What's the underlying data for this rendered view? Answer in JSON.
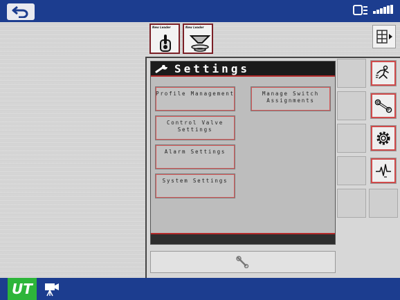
{
  "settings": {
    "title": "Settings",
    "buttons": [
      {
        "label": "Profile Management"
      },
      {
        "label": "Manage Switch Assignments"
      },
      {
        "label": "Control Valve Settings"
      },
      {
        "label": "Alarm Settings"
      },
      {
        "label": "System Settings"
      }
    ]
  },
  "tabs": [
    {
      "brand": "New Leader",
      "icon": "switch-toggle-icon"
    },
    {
      "brand": "New Leader",
      "icon": "spinner-spreader-icon"
    }
  ],
  "side_buttons": [
    {
      "icon": "running-person-icon"
    },
    {
      "icon": "wrench-icon"
    },
    {
      "icon": "gear-icon"
    },
    {
      "icon": "diagnostics-pulse-icon"
    }
  ],
  "bottom_bar": {
    "ut_label": "UT"
  },
  "colors": {
    "bar_blue": "#1c3d8f",
    "accent_red": "#b52a2a",
    "ut_green": "#2db53a"
  }
}
